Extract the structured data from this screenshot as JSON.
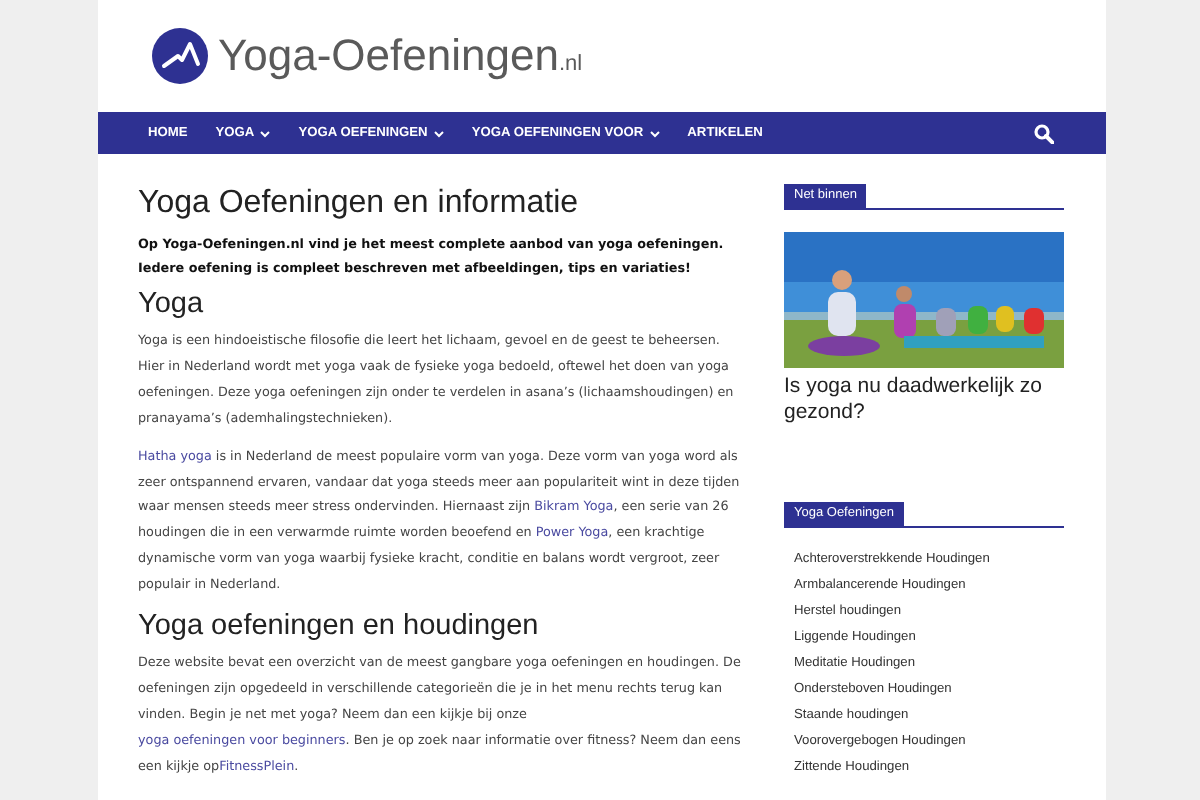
{
  "logo": {
    "name": "Yoga-Oefeningen",
    "suffix": ".nl"
  },
  "nav": {
    "items": [
      {
        "label": "HOME",
        "dropdown": false
      },
      {
        "label": "YOGA",
        "dropdown": true
      },
      {
        "label": "YOGA OEFENINGEN",
        "dropdown": true
      },
      {
        "label": "YOGA OEFENINGEN VOOR",
        "dropdown": true
      },
      {
        "label": "ARTIKELEN",
        "dropdown": false
      }
    ]
  },
  "main": {
    "title": "Yoga Oefeningen en informatie",
    "intro": "Op Yoga-Oefeningen.nl vind je het meest complete aanbod van yoga oefeningen. Iedere oefening is compleet beschreven met afbeeldingen, tips en variaties!",
    "sections": [
      {
        "heading": "Yoga",
        "paragraphs": [
          [
            {
              "text": "Yoga is een hindoeistische filosofie die leert het lichaam, gevoel en de geest te beheersen. Hier in Nederland wordt met yoga vaak de fysieke yoga bedoeld, oftewel het doen van yoga oefeningen. Deze yoga oefeningen zijn onder te verdelen in asana’s (lichaamshoudingen) en pranayama’s (ademhalingstechnieken).",
              "link": false
            }
          ],
          [
            {
              "text": "Hatha yoga",
              "link": true
            },
            {
              "text": " is in Nederland de meest populaire vorm van yoga. Deze vorm van yoga word als zeer ontspannend ervaren, vandaar dat yoga steeds meer aan populariteit wint in deze tijden waar mensen steeds meer stress ondervinden. Hiernaast zijn ",
              "link": false
            },
            {
              "text": "Bikram Yoga",
              "link": true
            },
            {
              "text": ", een serie van 26 houdingen die in een verwarmde ruimte worden beoefend en ",
              "link": false
            },
            {
              "text": "Power Yoga",
              "link": true
            },
            {
              "text": ", een krachtige dynamische vorm van yoga waarbij fysieke kracht, conditie en balans wordt vergroot, zeer populair in Nederland.",
              "link": false
            }
          ]
        ]
      },
      {
        "heading": "Yoga oefeningen en houdingen",
        "paragraphs": [
          [
            {
              "text": "Deze website bevat een overzicht van de meest gangbare yoga oefeningen en houdingen. De oefeningen zijn opgedeeld in verschillende categorieën die je in het menu rechts terug kan vinden. Begin je net met yoga? Neem dan een kijkje bij onze ",
              "link": false
            },
            {
              "text": "yoga oefeningen voor ",
              "link": true
            },
            {
              "text": "beginners",
              "link": true
            },
            {
              "text": ". Ben je op zoek naar informatie over fitness? Neem dan eens een kijkje op",
              "link": false
            },
            {
              "text": "FitnessPlein",
              "link": true
            },
            {
              "text": ".",
              "link": false
            }
          ]
        ]
      }
    ]
  },
  "sidebar": {
    "latest": {
      "label": "Net binnen",
      "post_title": "Is yoga nu daadwerkelijk zo gezond?"
    },
    "categories": {
      "label": "Yoga Oefeningen",
      "items": [
        "Achteroverstrekkende Houdingen",
        "Armbalancerende Houdingen",
        "Herstel houdingen",
        "Liggende Houdingen",
        "Meditatie Houdingen",
        "Ondersteboven Houdingen",
        "Staande houdingen",
        "Voorovergebogen Houdingen",
        "Zittende Houdingen"
      ]
    }
  }
}
